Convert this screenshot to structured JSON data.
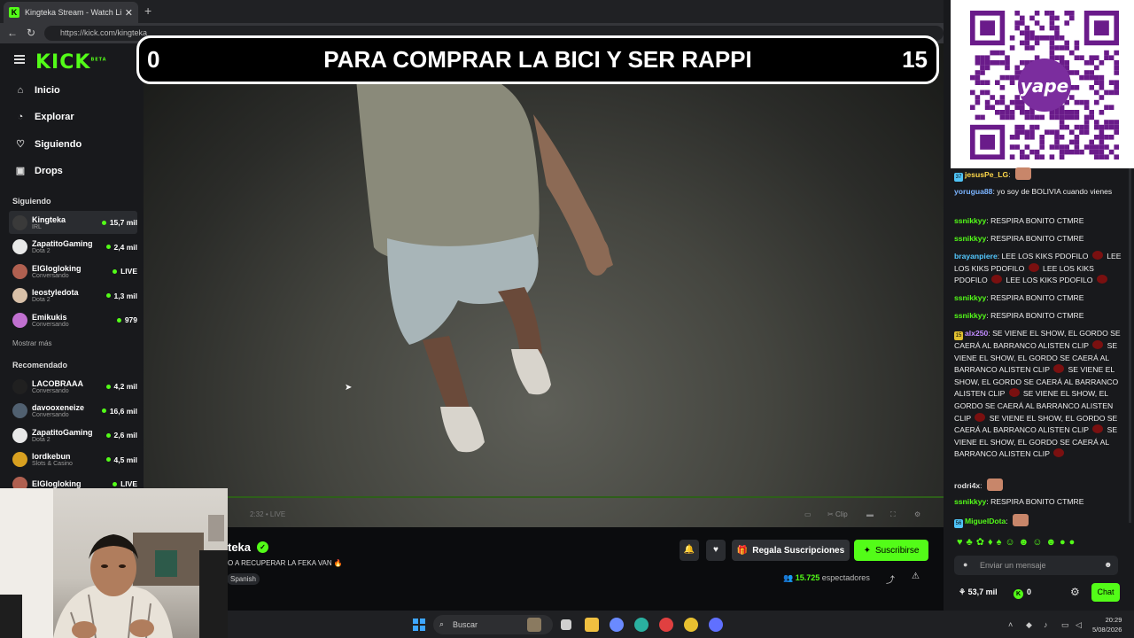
{
  "browser": {
    "tab_title": "Kingteka Stream - Watch Live on K",
    "favicon_letter": "K",
    "close_glyph": "✕",
    "newtab_glyph": "+",
    "url": "https://kick.com/kingteka",
    "back_glyph": "←",
    "forward_glyph": "→",
    "reload_glyph": "↻"
  },
  "sidebar": {
    "logo": "KICK",
    "logo_badge": "BETA",
    "nav": [
      {
        "label": "Inicio",
        "icon": "home-icon"
      },
      {
        "label": "Explorar",
        "icon": "compass-icon"
      },
      {
        "label": "Siguiendo",
        "icon": "heart-icon"
      },
      {
        "label": "Drops",
        "icon": "gift-icon"
      }
    ],
    "following_header": "Siguiendo",
    "following": [
      {
        "name": "Kingteka",
        "category": "IRL",
        "viewers": "15,7 mil",
        "avatar_color": "#3a3a3a"
      },
      {
        "name": "ZapatitoGaming",
        "category": "Dota 2",
        "viewers": "2,4 mil",
        "avatar_color": "#e8e8e8"
      },
      {
        "name": "ElGlogloking",
        "category": "Conversando",
        "viewers": "LIVE",
        "avatar_color": "#b06050"
      },
      {
        "name": "leostyledota",
        "category": "Dota 2",
        "viewers": "1,3 mil",
        "avatar_color": "#d8c0a8"
      },
      {
        "name": "Emikukis",
        "category": "Conversando",
        "viewers": "979",
        "avatar_color": "#c070d0"
      }
    ],
    "show_more": "Mostrar más",
    "recommended_header": "Recomendado",
    "recommended": [
      {
        "name": "LACOBRAAA",
        "category": "Conversando",
        "viewers": "4,2 mil",
        "avatar_color": "#202020"
      },
      {
        "name": "davooxeneize",
        "category": "Conversando",
        "viewers": "16,6 mil",
        "avatar_color": "#506070"
      },
      {
        "name": "ZapatitoGaming",
        "category": "Dota 2",
        "viewers": "2,6 mil",
        "avatar_color": "#e8e8e8"
      },
      {
        "name": "lordkebun",
        "category": "Slots & Casino",
        "viewers": "4,5 mil",
        "avatar_color": "#d8a020"
      },
      {
        "name": "ElGlogloking",
        "category": "",
        "viewers": "LIVE",
        "avatar_color": "#b06050"
      }
    ]
  },
  "video": {
    "banner_left": "0",
    "banner_text": "PARA COMPRAR LA BICI Y SER RAPPI",
    "banner_right": "15",
    "time": "2:32",
    "live_label": "• LIVE",
    "clip_label": "Clip"
  },
  "stream_info": {
    "name": "teka",
    "title": "O A RECUPERAR LA FEKA VAN 🔥",
    "language": "Spanish",
    "gift_button": "Regala Suscripciones",
    "subscribe_button": "Suscribirse",
    "viewers_count": "15.725",
    "viewers_label": "espectadores"
  },
  "chat": {
    "messages": [
      {
        "user": "jesusPe_LG",
        "color": "#ffd84a",
        "text": "",
        "badge": "37",
        "badge_color": "#4fc3f7",
        "emote_img": true
      },
      {
        "user": "yorugua88",
        "color": "#7ab3ff",
        "text": "yo soy de BOLIVIA cuando vienes"
      },
      {
        "user": "ssnikkyy",
        "color": "#53fc18",
        "text": "RESPIRA BONITO CTMRE"
      },
      {
        "user": "ssnikkyy",
        "color": "#53fc18",
        "text": "RESPIRA BONITO CTMRE"
      },
      {
        "user": "brayanpiere",
        "color": "#53c8ff",
        "text": "LEE LOS KIKS PDOFILO ● LEE LOS KIKS PDOFILO ● LEE LOS KIKS PDOFILO ● LEE LOS KIKS PDOFILO ●"
      },
      {
        "user": "ssnikkyy",
        "color": "#53fc18",
        "text": "RESPIRA BONITO CTMRE"
      },
      {
        "user": "ssnikkyy",
        "color": "#53fc18",
        "text": "RESPIRA BONITO CTMRE"
      },
      {
        "user": "alx250",
        "color": "#c08cff",
        "badge": "15",
        "badge_color": "#e0c030",
        "text": "SE VIENE EL SHOW, EL GORDO SE CAERÁ AL BARRANCO ALISTEN CLIP ● SE VIENE EL SHOW, EL GORDO SE CAERÁ AL BARRANCO ALISTEN CLIP ● SE VIENE EL SHOW, EL GORDO SE CAERÁ AL BARRANCO ALISTEN CLIP ● SE VIENE EL SHOW, EL GORDO SE CAERÁ AL BARRANCO ALISTEN CLIP ● SE VIENE EL SHOW, EL GORDO SE CAERÁ AL BARRANCO ALISTEN CLIP ● SE VIENE EL SHOW, EL GORDO SE CAERÁ AL BARRANCO ALISTEN CLIP ●"
      },
      {
        "user": "rodri4x",
        "color": "#e0e0e0",
        "text": "",
        "emote_img": true
      },
      {
        "user": "ssnikkyy",
        "color": "#53fc18",
        "text": "RESPIRA BONITO CTMRE"
      },
      {
        "user": "MiguelDota",
        "color": "#53fc18",
        "badge": "56",
        "badge_color": "#4fc3f7",
        "text": "",
        "emote_img": true
      }
    ],
    "input_placeholder": "Enviar un mensaje",
    "points": "53,7 mil",
    "kicks": "0",
    "chat_button": "Chat"
  },
  "taskbar": {
    "search_placeholder": "Buscar",
    "time": "20:29",
    "date": "5/08/2026"
  }
}
